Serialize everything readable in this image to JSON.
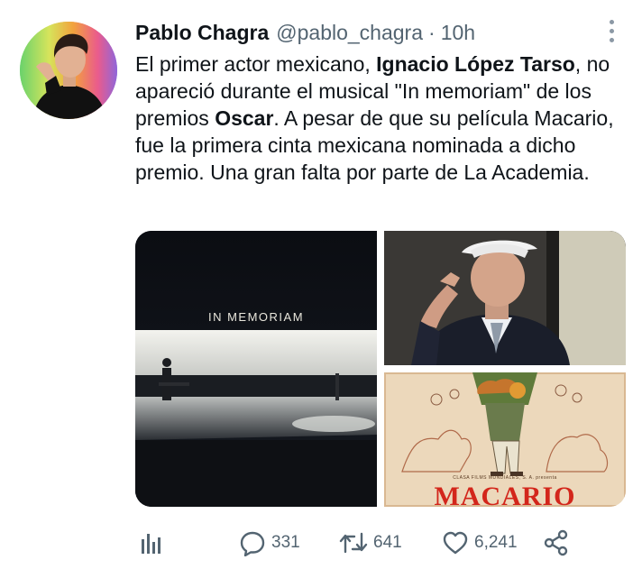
{
  "author": {
    "name": "Pablo Chagra",
    "handle": "@pablo_chagra",
    "separator": "·",
    "time": "10h"
  },
  "tweet": {
    "segments": [
      {
        "text": "El primer actor mexicano, ",
        "bold": false
      },
      {
        "text": "Ignacio López Tarso",
        "bold": true
      },
      {
        "text": ", no apareció durante el musical \"In memoriam\" de los premios ",
        "bold": false
      },
      {
        "text": "Oscar",
        "bold": true
      },
      {
        "text": ". A pesar de que su película Macario, fue la primera cinta mexicana nominada a dicho premio. Una gran falta por parte de La Academia.",
        "bold": false
      }
    ]
  },
  "media": {
    "image1_caption": "IN MEMORIAM",
    "image3_credit": "CLASA FILMS MUNDIALES, S. A. presenta",
    "image3_title": "MACARIO"
  },
  "actions": {
    "replies": "331",
    "retweets": "641",
    "likes": "6,241"
  },
  "icons": {
    "more": "more-vertical-icon",
    "analytics": "analytics-icon",
    "reply": "reply-icon",
    "retweet": "retweet-icon",
    "like": "heart-icon",
    "share": "share-icon"
  },
  "colors": {
    "text": "#0f1419",
    "secondary": "#536471",
    "poster_red": "#d3261b"
  }
}
